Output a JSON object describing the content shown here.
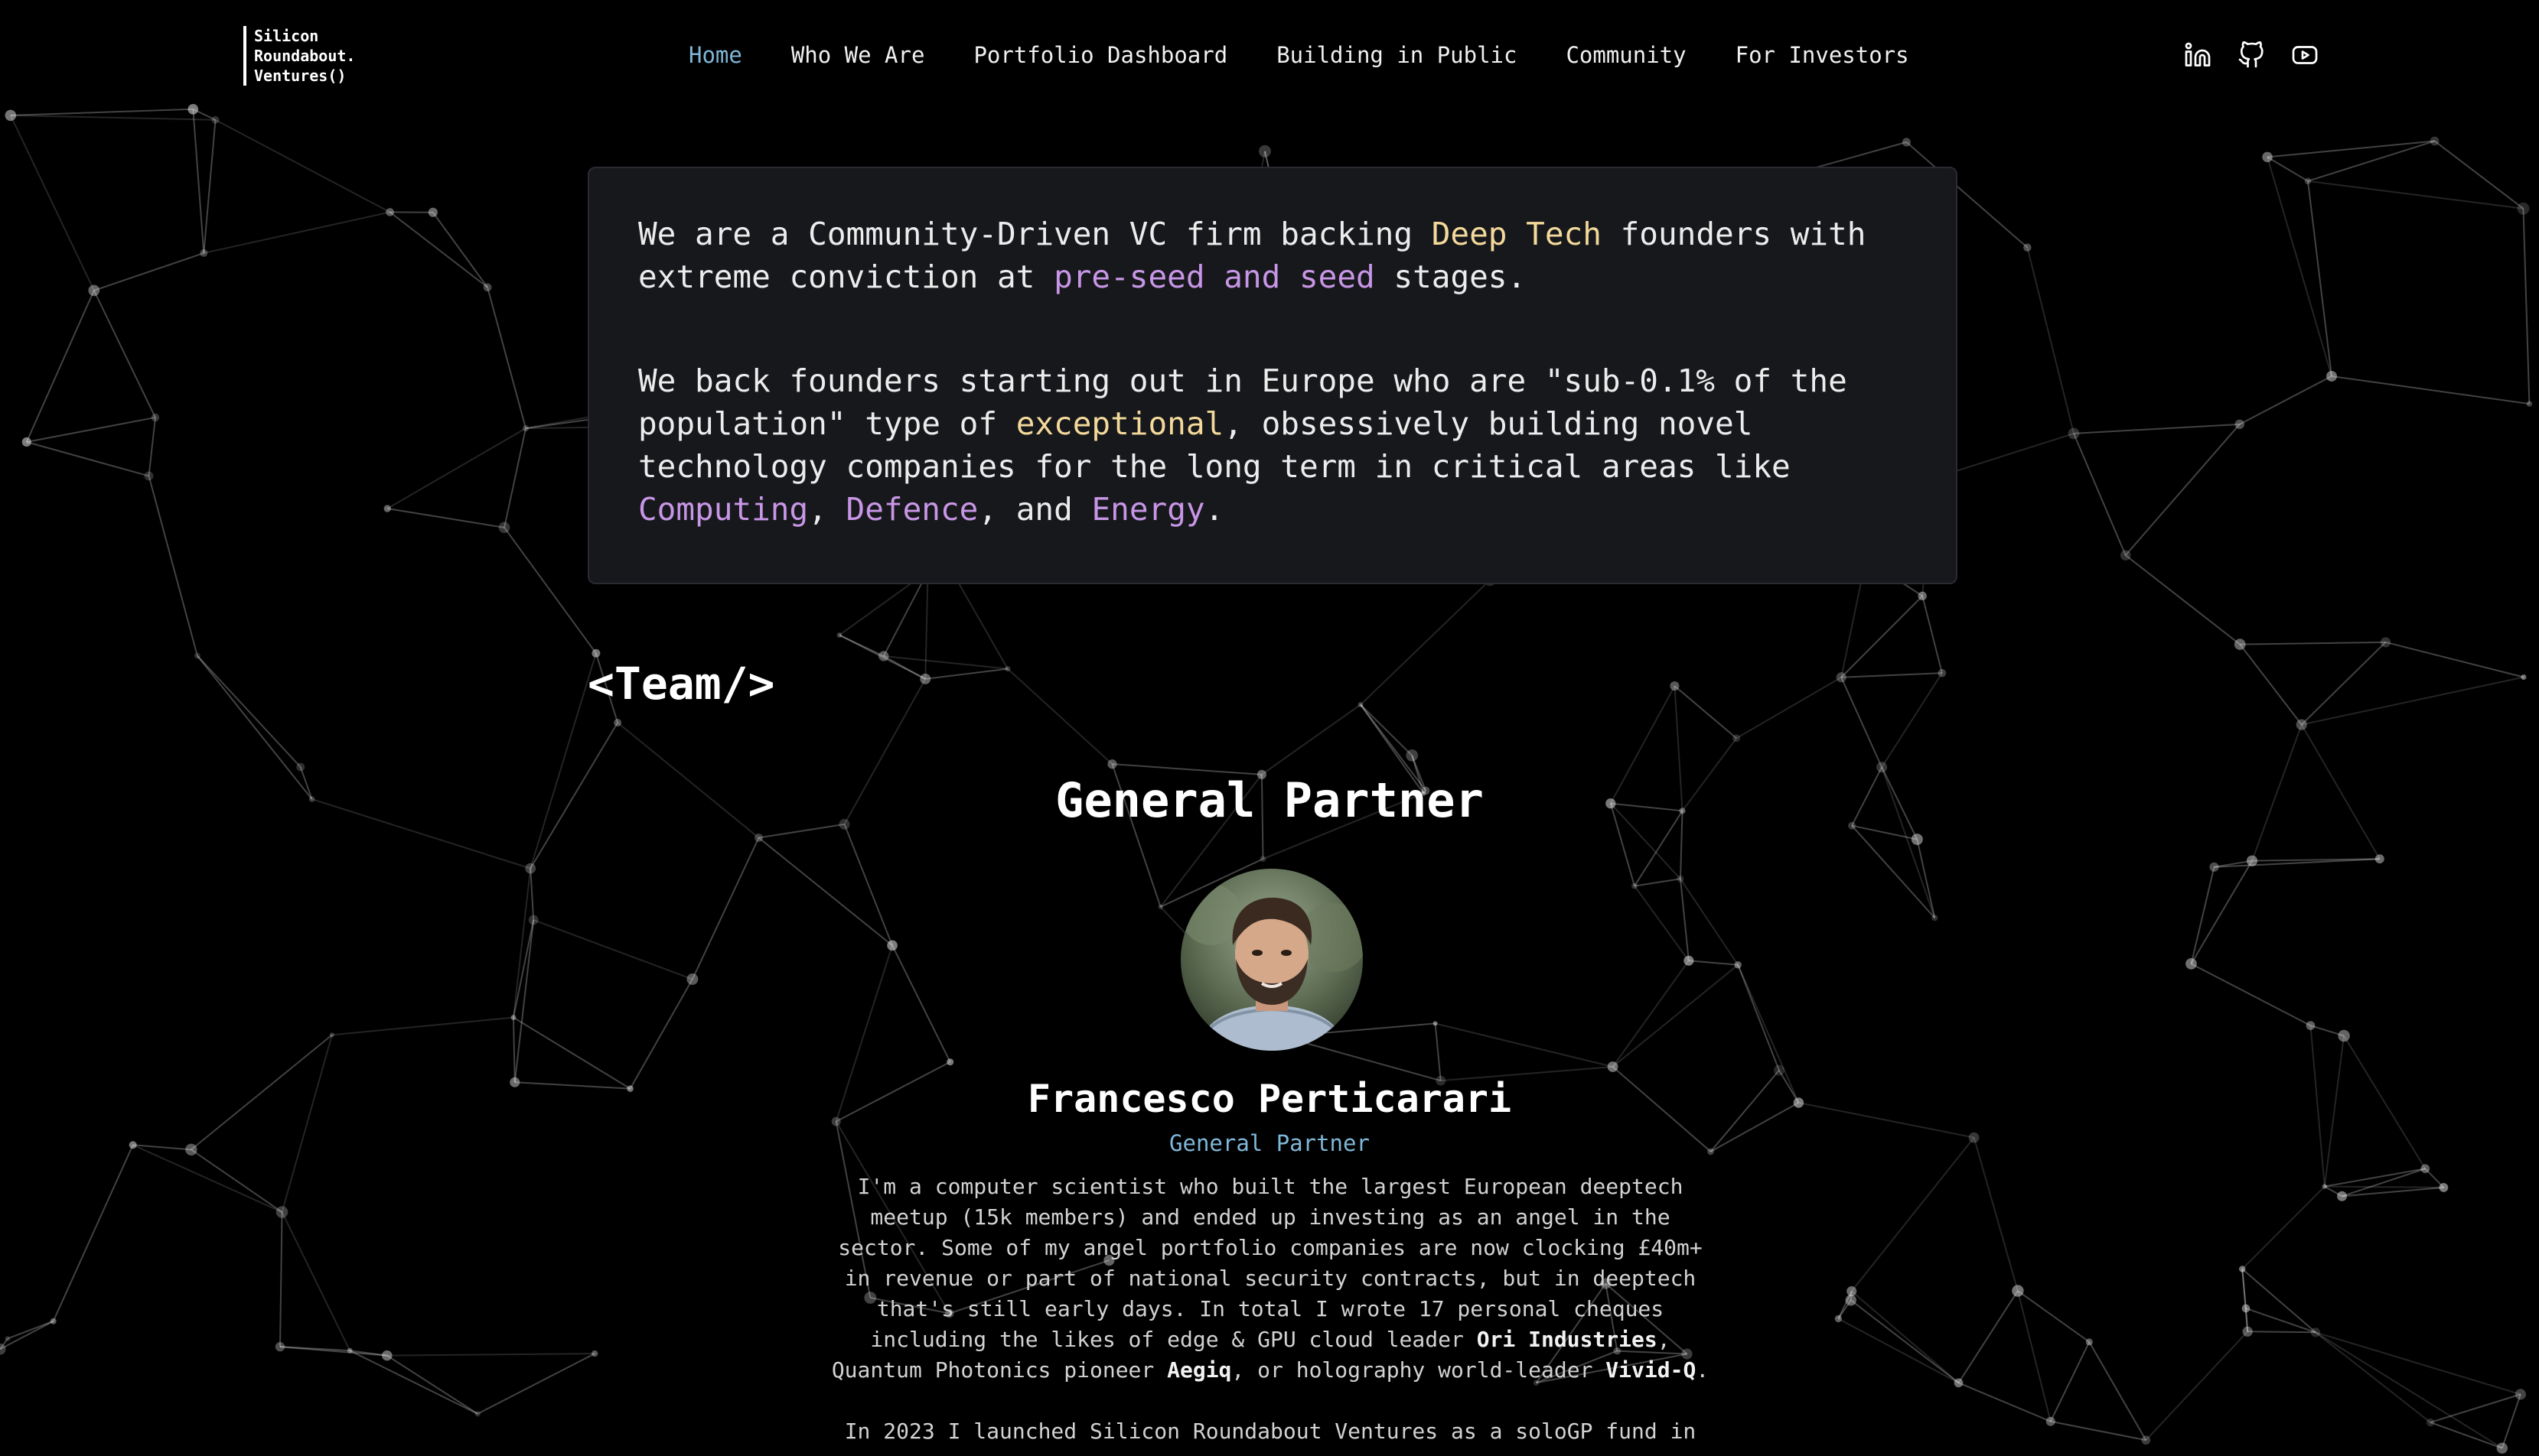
{
  "header": {
    "logo_lines": [
      "Silicon",
      "Roundabout.",
      "Ventures()"
    ],
    "nav": [
      {
        "label": "Home",
        "active": true
      },
      {
        "label": "Who We Are"
      },
      {
        "label": "Portfolio Dashboard"
      },
      {
        "label": "Building in Public"
      },
      {
        "label": "Community"
      },
      {
        "label": "For Investors"
      }
    ],
    "social_icons": [
      "linkedin-icon",
      "github-icon",
      "youtube-icon"
    ]
  },
  "intro": {
    "p1": {
      "a": "We are a Community-Driven VC firm backing ",
      "b": "Deep Tech",
      "c": " founders with extreme conviction at ",
      "d": "pre-seed and seed",
      "e": " stages."
    },
    "p2": {
      "a": "We back founders starting out in Europe who are \"sub-0.1% of the population\" type of ",
      "b": "exceptional",
      "c": ", obsessively building novel technology companies for the long term in critical areas like ",
      "d": "Computing",
      "e": ", ",
      "f": "Defence",
      "g": ", and ",
      "h": "Energy",
      "i": "."
    }
  },
  "team": {
    "title": "<Team/>",
    "section_title": "General Partner",
    "person": {
      "name": "Francesco Perticarari",
      "role": "General Partner",
      "bio1": {
        "a": "I'm a computer scientist who built the largest European deeptech meetup (15k members) and ended up investing as an angel in the sector. Some of my angel portfolio companies are now clocking £40m+ in revenue or part of national security contracts, but in deeptech that's still early days. In total I wrote 17 personal cheques including the likes of edge & GPU cloud leader ",
        "b": "Ori Industries",
        "c": ", Quantum Photonics pioneer ",
        "d": "Aegiq",
        "e": ", or holography world-leader ",
        "f": "Vivid-Q",
        "g": "."
      },
      "bio2": "In 2023 I launched Silicon Roundabout Ventures as a soloGP fund in"
    }
  },
  "colors": {
    "background": "#000000",
    "card": "#17181c",
    "accent_blue": "#7fb7d8",
    "highlight_yellow": "#f3d99a",
    "highlight_purple": "#c896e6"
  }
}
